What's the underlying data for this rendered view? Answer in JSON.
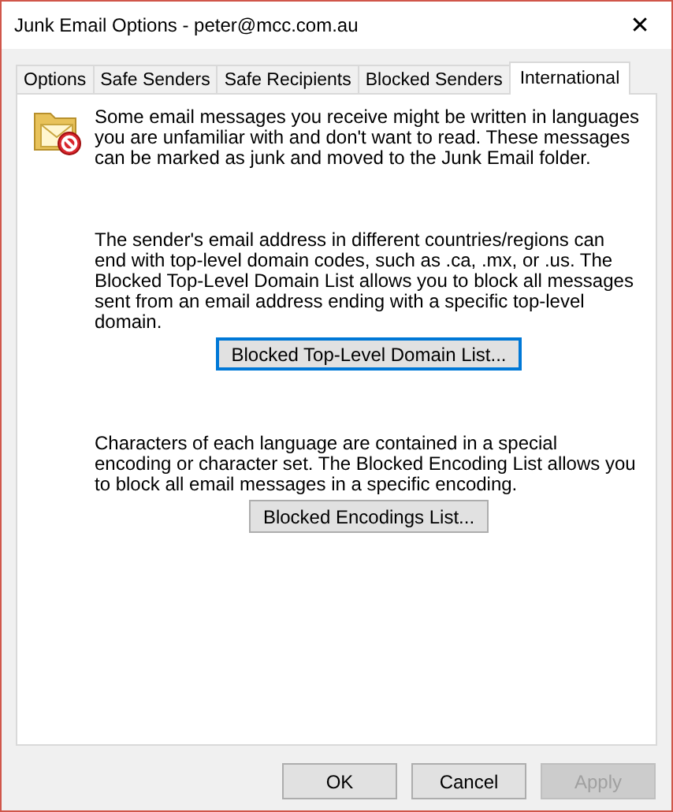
{
  "window": {
    "title": "Junk Email Options - peter@mcc.com.au",
    "close": "✕"
  },
  "tabs": [
    {
      "label": "Options",
      "selected": false
    },
    {
      "label": "Safe Senders",
      "selected": false
    },
    {
      "label": "Safe Recipients",
      "selected": false
    },
    {
      "label": "Blocked Senders",
      "selected": false
    },
    {
      "label": "International",
      "selected": true
    }
  ],
  "intro": "Some email messages you receive might be written in languages you are unfamiliar with and don't want to read. These messages can be marked as junk and moved to the Junk Email folder.",
  "sections": [
    {
      "text": "The sender's email address in different countries/regions can end with top-level domain codes, such as .ca, .mx, or .us. The Blocked Top-Level Domain List allows you to block all messages sent from an email address ending with a specific top-level domain.",
      "button": {
        "label": "Blocked Top-Level Domain List...",
        "focused": true
      }
    },
    {
      "text": "Characters of each language are contained in a special encoding or character set. The Blocked Encoding List allows you to block all email messages in a specific encoding.",
      "button": {
        "label": "Blocked Encodings List...",
        "focused": false
      }
    }
  ],
  "buttons": [
    {
      "label": "OK",
      "disabled": false
    },
    {
      "label": "Cancel",
      "disabled": false
    },
    {
      "label": "Apply",
      "disabled": true
    }
  ]
}
